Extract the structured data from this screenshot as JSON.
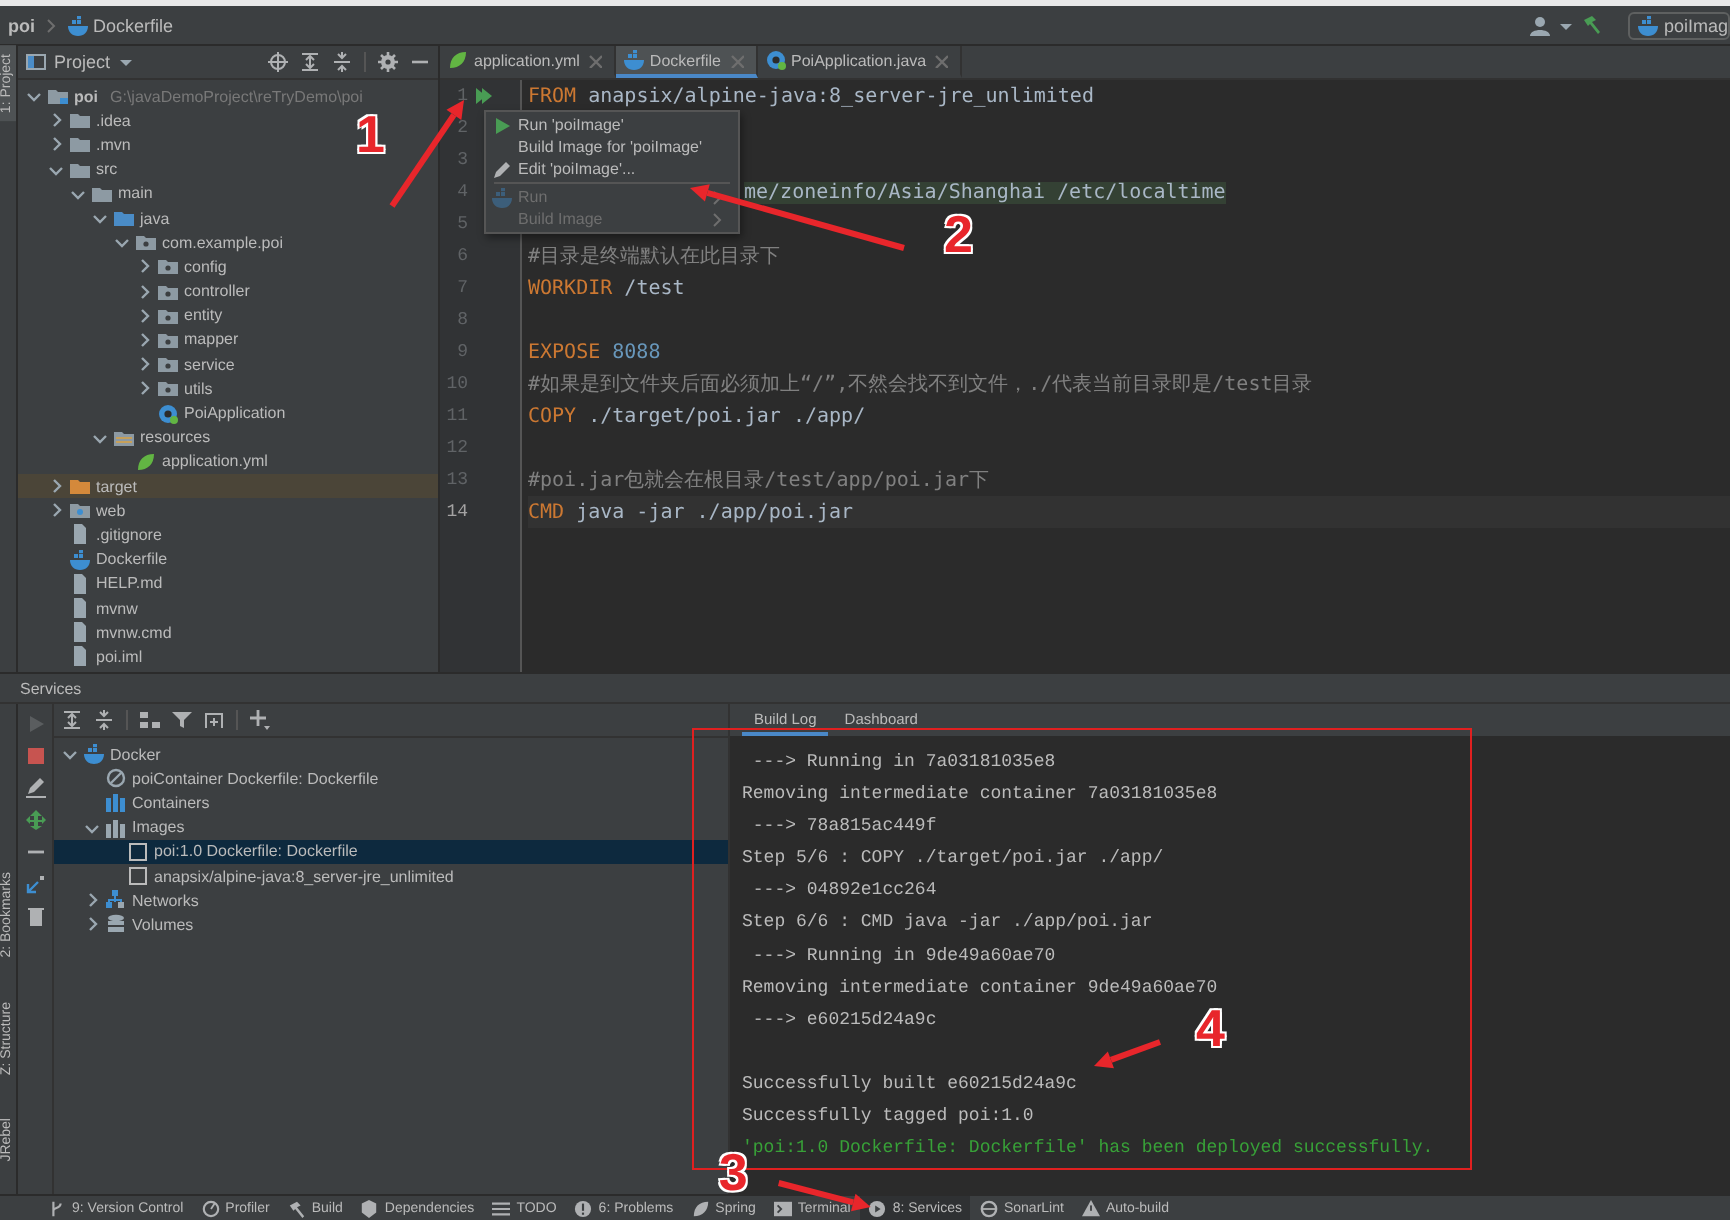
{
  "nav_bar": {
    "breadcrumb": [
      {
        "label": "poi"
      },
      {
        "label": "Dockerfile",
        "kind": "docker"
      }
    ],
    "run_config": "poiImag"
  },
  "side_strips": {
    "top": [
      "1: Project"
    ],
    "bottom": [
      "2: Bookmarks",
      "Z: Structure",
      "JRebel"
    ]
  },
  "project_panel": {
    "title": "Project",
    "tree": [
      {
        "name": "poi",
        "path": "G:\\javaDemoProject\\reTryDemo\\poi",
        "kind": "module",
        "expanded": true,
        "children": [
          {
            "name": ".idea",
            "kind": "folder",
            "expanded": false
          },
          {
            "name": ".mvn",
            "kind": "folder",
            "expanded": false
          },
          {
            "name": "src",
            "kind": "folder",
            "expanded": true,
            "children": [
              {
                "name": "main",
                "kind": "folder",
                "expanded": true,
                "children": [
                  {
                    "name": "java",
                    "kind": "source",
                    "expanded": true,
                    "children": [
                      {
                        "name": "com.example.poi",
                        "kind": "package",
                        "expanded": true,
                        "children": [
                          {
                            "name": "config",
                            "kind": "package",
                            "expanded": false
                          },
                          {
                            "name": "controller",
                            "kind": "package",
                            "expanded": false
                          },
                          {
                            "name": "entity",
                            "kind": "package",
                            "expanded": false
                          },
                          {
                            "name": "mapper",
                            "kind": "package",
                            "expanded": false
                          },
                          {
                            "name": "service",
                            "kind": "package",
                            "expanded": false
                          },
                          {
                            "name": "utils",
                            "kind": "package",
                            "expanded": false
                          },
                          {
                            "name": "PoiApplication",
                            "kind": "class"
                          }
                        ]
                      }
                    ]
                  },
                  {
                    "name": "resources",
                    "kind": "resources",
                    "expanded": true,
                    "children": [
                      {
                        "name": "application.yml",
                        "kind": "yml"
                      }
                    ]
                  }
                ]
              }
            ]
          },
          {
            "name": "target",
            "kind": "excluded",
            "expanded": false
          },
          {
            "name": "web",
            "kind": "web",
            "expanded": false
          },
          {
            "name": ".gitignore",
            "kind": "file"
          },
          {
            "name": "Dockerfile",
            "kind": "docker"
          },
          {
            "name": "HELP.md",
            "kind": "file"
          },
          {
            "name": "mvnw",
            "kind": "file"
          },
          {
            "name": "mvnw.cmd",
            "kind": "file"
          },
          {
            "name": "poi.iml",
            "kind": "file"
          }
        ]
      }
    ]
  },
  "editor": {
    "tabs": [
      {
        "label": "application.yml",
        "kind": "yml",
        "selected": false
      },
      {
        "label": "Dockerfile",
        "kind": "docker",
        "selected": true
      },
      {
        "label": "PoiApplication.java",
        "kind": "class",
        "selected": false
      }
    ],
    "lines": [
      {
        "number": "1",
        "run_marker": true,
        "tokens": [
          {
            "kind": "keyword",
            "text": "FROM"
          },
          {
            "kind": "text",
            "text": " anapsix/alpine-java:8_server-jre_unlimited"
          }
        ]
      },
      {
        "number": "2"
      },
      {
        "number": "3"
      },
      {
        "number": "4",
        "covered": true,
        "highlighted": true,
        "tokens": [
          {
            "kind": "text",
            "text": "me/zoneinfo/Asia/Shanghai /etc/localtime"
          }
        ]
      },
      {
        "number": "5"
      },
      {
        "number": "6",
        "tokens": [
          {
            "kind": "comment",
            "text": "#目录是终端默认在此目录下"
          }
        ]
      },
      {
        "number": "7",
        "tokens": [
          {
            "kind": "keyword",
            "text": "WORKDIR"
          },
          {
            "kind": "text",
            "text": " /test"
          }
        ]
      },
      {
        "number": "8"
      },
      {
        "number": "9",
        "tokens": [
          {
            "kind": "keyword",
            "text": "EXPOSE"
          },
          {
            "kind": "number",
            "text": " 8088"
          }
        ]
      },
      {
        "number": "10",
        "tokens": [
          {
            "kind": "comment",
            "text": "#如果是到文件夹后面必须加上“/”,不然会找不到文件，./代表当前目录即是/test目录"
          }
        ]
      },
      {
        "number": "11",
        "tokens": [
          {
            "kind": "keyword",
            "text": "COPY"
          },
          {
            "kind": "text",
            "text": " ./target/poi.jar ./app/"
          }
        ]
      },
      {
        "number": "12"
      },
      {
        "number": "13",
        "tokens": [
          {
            "kind": "comment",
            "text": "#poi.jar包就会在根目录/test/app/poi.jar下"
          }
        ]
      },
      {
        "number": "14",
        "current": true,
        "tokens": [
          {
            "kind": "keyword",
            "text": "CMD"
          },
          {
            "kind": "text",
            "text": " java -jar ./app/poi.jar"
          }
        ]
      }
    ],
    "popup": {
      "groups": [
        [
          {
            "label": "Run 'poiImage'",
            "kind": "run",
            "disabled": false,
            "submenu": false
          },
          {
            "label": "Build Image for 'poiImage'",
            "kind": "plain",
            "disabled": false,
            "submenu": false
          },
          {
            "label": "Edit 'poiImage'...",
            "kind": "edit",
            "disabled": false,
            "submenu": false
          }
        ],
        [
          {
            "label": "Run",
            "kind": "docker",
            "disabled": true,
            "submenu": true
          },
          {
            "label": "Build Image",
            "kind": "plain",
            "disabled": true,
            "submenu": true
          }
        ]
      ]
    }
  },
  "services": {
    "title": "Services",
    "tree": [
      {
        "name": "Docker",
        "kind": "docker",
        "expanded": true,
        "selected": false,
        "children": [
          {
            "name": "poiContainer Dockerfile: Dockerfile",
            "kind": "stopped",
            "selected": false
          },
          {
            "name": "Containers",
            "kind": "containers",
            "selected": false
          },
          {
            "name": "Images",
            "kind": "images",
            "expanded": true,
            "selected": false,
            "children": [
              {
                "name": "poi:1.0 Dockerfile: Dockerfile",
                "kind": "image",
                "selected": true
              },
              {
                "name": "anapsix/alpine-java:8_server-jre_unlimited",
                "kind": "image",
                "selected": false
              }
            ]
          },
          {
            "name": "Networks",
            "kind": "network",
            "expanded": false,
            "selected": false
          },
          {
            "name": "Volumes",
            "kind": "volume",
            "expanded": false,
            "selected": false
          }
        ]
      }
    ],
    "log": {
      "tabs": [
        {
          "label": "Build Log",
          "selected": true
        },
        {
          "label": "Dashboard",
          "selected": false
        }
      ],
      "blocks": [
        [
          {
            "text": " ---> Running in 7a03181035e8",
            "kind": "plain"
          },
          {
            "text": "Removing intermediate container 7a03181035e8",
            "kind": "plain"
          },
          {
            "text": " ---> 78a815ac449f",
            "kind": "plain"
          },
          {
            "text": "Step 5/6 : COPY ./target/poi.jar ./app/",
            "kind": "plain"
          },
          {
            "text": " ---> 04892e1cc264",
            "kind": "plain"
          },
          {
            "text": "Step 6/6 : CMD java -jar ./app/poi.jar",
            "kind": "plain"
          },
          {
            "text": " ---> Running in 9de49a60ae70",
            "kind": "plain"
          },
          {
            "text": "Removing intermediate container 9de49a60ae70",
            "kind": "plain"
          },
          {
            "text": " ---> e60215d24a9c",
            "kind": "plain"
          }
        ],
        [
          {
            "text": "Successfully built e60215d24a9c",
            "kind": "plain"
          },
          {
            "text": "Successfully tagged poi:1.0",
            "kind": "plain"
          },
          {
            "text": "'poi:1.0 Dockerfile: Dockerfile' has been deployed successfully.",
            "kind": "success"
          }
        ]
      ]
    }
  },
  "status_bar": {
    "tools": [
      {
        "label": "9: Version Control",
        "kind": "vcs",
        "selected": false
      },
      {
        "label": "Profiler",
        "kind": "profiler",
        "selected": false
      },
      {
        "label": "Build",
        "kind": "build",
        "selected": false
      },
      {
        "label": "Dependencies",
        "kind": "dependencies",
        "selected": false
      },
      {
        "label": "TODO",
        "kind": "todo",
        "selected": false
      },
      {
        "label": "6: Problems",
        "kind": "problems",
        "selected": false
      },
      {
        "label": "Spring",
        "kind": "spring",
        "selected": false
      },
      {
        "label": "Terminal",
        "kind": "terminal",
        "selected": false
      },
      {
        "label": "8: Services",
        "kind": "services",
        "selected": true
      },
      {
        "label": "SonarLint",
        "kind": "sonar",
        "selected": false
      },
      {
        "label": "Auto-build",
        "kind": "autobuild",
        "selected": false
      }
    ]
  },
  "annotations": {
    "numbers": [
      "1",
      "2",
      "3",
      "4"
    ]
  }
}
